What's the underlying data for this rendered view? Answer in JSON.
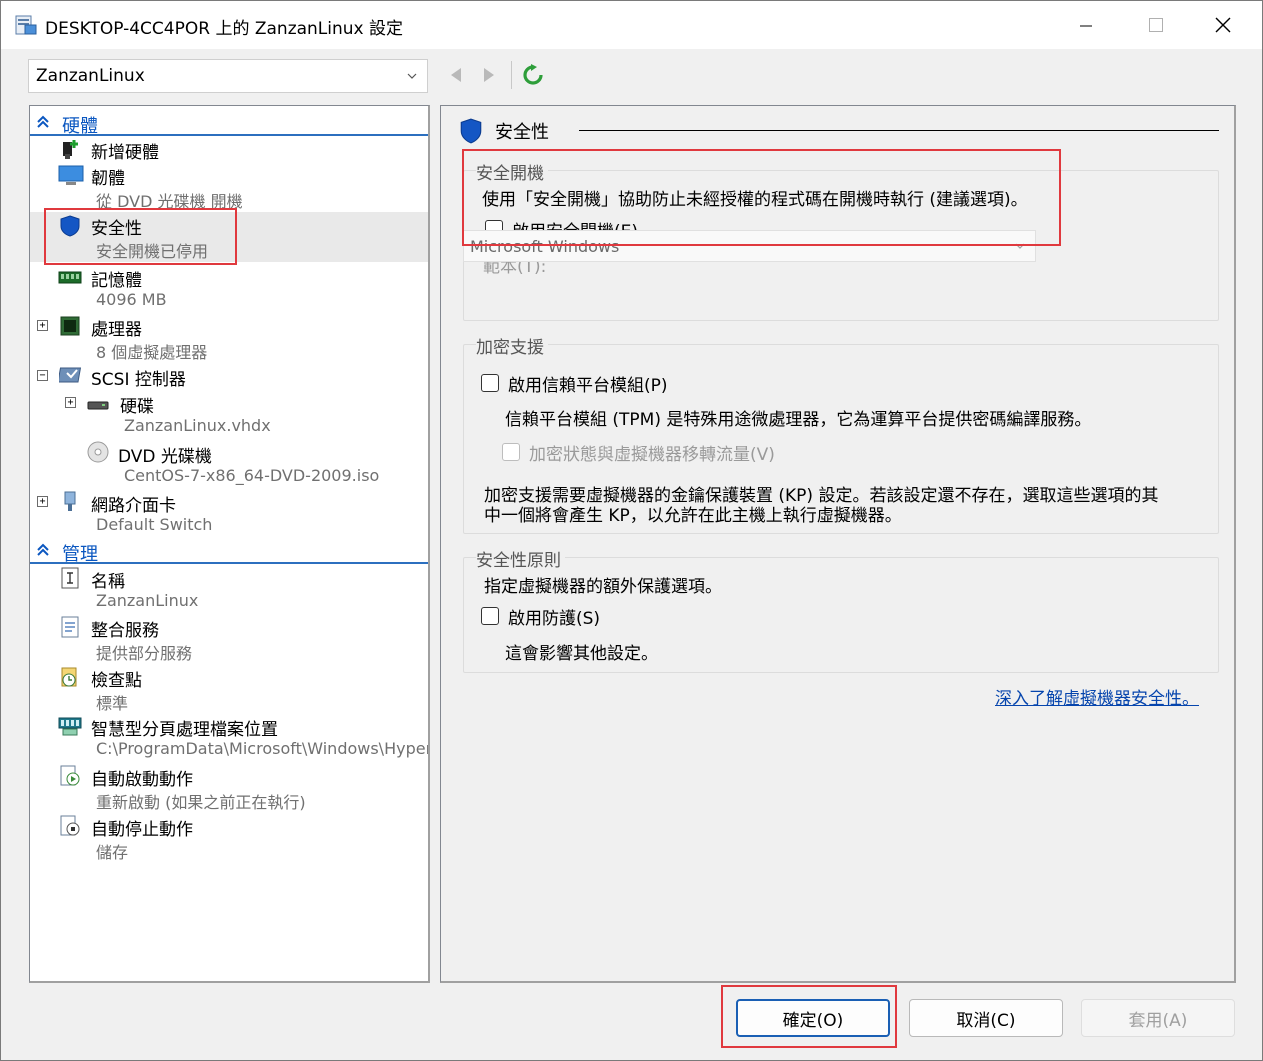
{
  "window": {
    "title": "DESKTOP-4CC4POR 上的 ZanzanLinux 設定"
  },
  "vm_select": {
    "value": "ZanzanLinux"
  },
  "tree": {
    "hardware_header": "硬體",
    "hardware": [
      {
        "name": "add-hardware",
        "label": "新增硬體",
        "sub": ""
      },
      {
        "name": "firmware",
        "label": "韌體",
        "sub": "從 DVD 光碟機 開機"
      },
      {
        "name": "security",
        "label": "安全性",
        "sub": "安全開機已停用"
      },
      {
        "name": "memory",
        "label": "記憶體",
        "sub": "4096 MB"
      },
      {
        "name": "processor",
        "label": "處理器",
        "sub": "8 個虛擬處理器"
      },
      {
        "name": "scsi",
        "label": "SCSI 控制器",
        "sub": ""
      },
      {
        "name": "hard-drive",
        "label": "硬碟",
        "sub": "ZanzanLinux.vhdx"
      },
      {
        "name": "dvd-drive",
        "label": "DVD 光碟機",
        "sub": "CentOS-7-x86_64-DVD-2009.iso"
      },
      {
        "name": "network-adapter",
        "label": "網路介面卡",
        "sub": "Default Switch"
      }
    ],
    "management_header": "管理",
    "management": [
      {
        "name": "name",
        "label": "名稱",
        "sub": "ZanzanLinux"
      },
      {
        "name": "integration-services",
        "label": "整合服務",
        "sub": "提供部分服務"
      },
      {
        "name": "checkpoints",
        "label": "檢查點",
        "sub": "標準"
      },
      {
        "name": "smart-paging",
        "label": "智慧型分頁處理檔案位置",
        "sub": "C:\\ProgramData\\Microsoft\\Windows\\Hyper-V"
      },
      {
        "name": "auto-start",
        "label": "自動啟動動作",
        "sub": "重新啟動 (如果之前正在執行)"
      },
      {
        "name": "auto-stop",
        "label": "自動停止動作",
        "sub": "儲存"
      }
    ]
  },
  "pane": {
    "title": "安全性",
    "secure_boot": {
      "title": "安全開機",
      "desc": "使用「安全開機」協助防止未經授權的程式碼在開機時執行 (建議選項)。",
      "checkbox": "啟用安全開機(E)",
      "template_label": "範本(T):",
      "template_value": "Microsoft Windows"
    },
    "encryption": {
      "title": "加密支援",
      "tpm_checkbox": "啟用信賴平台模組(P)",
      "tpm_desc": "信賴平台模組 (TPM) 是特殊用途微處理器，它為運算平台提供密碼編譯服務。",
      "encrypt_checkbox": "加密狀態與虛擬機器移轉流量(V)",
      "kp_desc_1": "加密支援需要虛擬機器的金鑰保護裝置 (KP) 設定。若該設定還不存在，選取這些選項的其",
      "kp_desc_2": "中一個將會產生 KP，以允許在此主機上執行虛擬機器。"
    },
    "policy": {
      "title": "安全性原則",
      "desc": "指定虛擬機器的額外保護選項。",
      "shielding_checkbox": "啟用防護(S)",
      "shielding_desc": "這會影響其他設定。"
    },
    "learn_more": "深入了解虛擬機器安全性。"
  },
  "buttons": {
    "ok": "確定(O)",
    "cancel": "取消(C)",
    "apply": "套用(A)"
  },
  "colors": {
    "accent": "#2c6fbf",
    "highlight": "#e0393e",
    "link": "#0645ad"
  }
}
